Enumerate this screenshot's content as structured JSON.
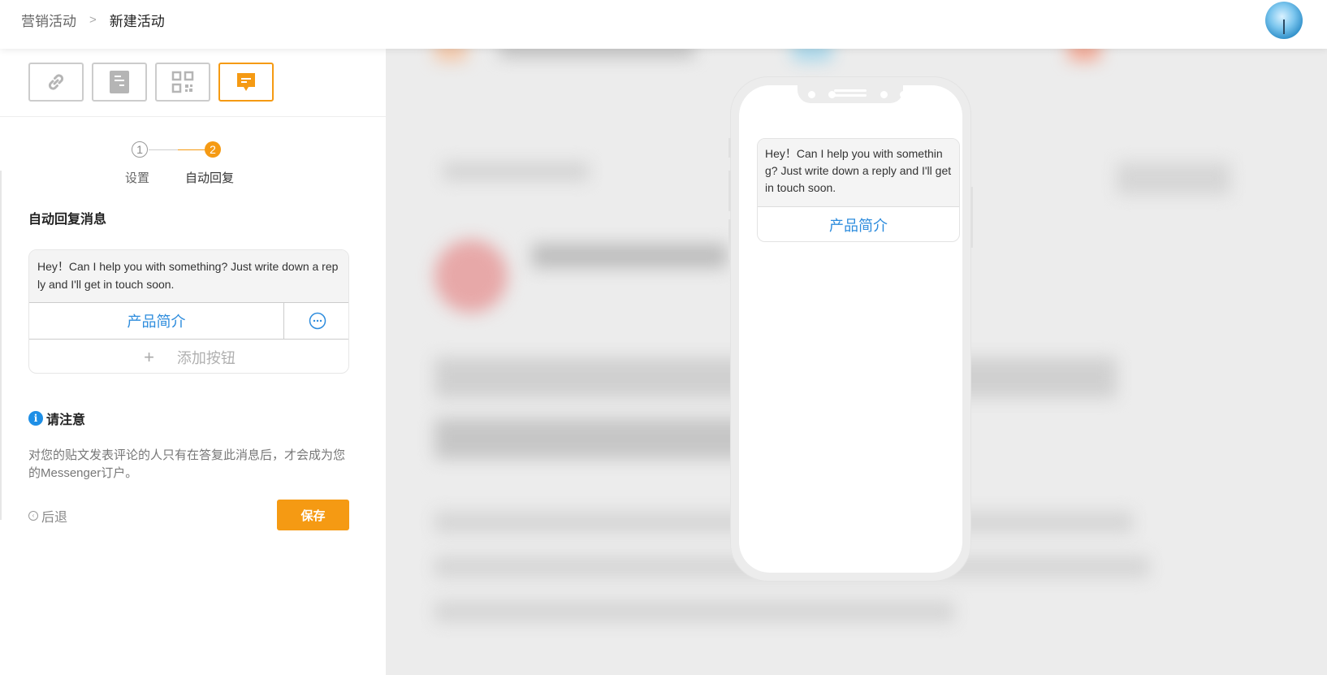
{
  "breadcrumb": {
    "parent": "营销活动",
    "separator": ">",
    "current": "新建活动"
  },
  "type_buttons": [
    {
      "icon": "link-icon",
      "active": false
    },
    {
      "icon": "document-icon",
      "active": false
    },
    {
      "icon": "qr-code-icon",
      "active": false
    },
    {
      "icon": "message-icon",
      "active": true
    }
  ],
  "steps": {
    "step1": {
      "number": "1",
      "label": "设置"
    },
    "step2": {
      "number": "2",
      "label": "自动回复"
    }
  },
  "auto_reply": {
    "section_title": "自动回复消息",
    "message_text": "Hey！Can I help you with something? Just write down a reply and I'll get in touch soon.",
    "button_label": "产品简介",
    "add_button_label": "添加按钮",
    "add_button_plus": "+"
  },
  "notice": {
    "icon_glyph": "i",
    "title": "请注意",
    "text": "对您的贴文发表评论的人只有在答复此消息后，才会成为您的Messenger订户。"
  },
  "footer": {
    "back_label": "后退",
    "save_label": "保存"
  },
  "preview": {
    "message_text": "Hey！Can I help you with something? Just write down a reply and I'll get in touch soon.",
    "button_label": "产品简介"
  },
  "colors": {
    "accent": "#f59a13",
    "link": "#2d8cdd",
    "info": "#1e8fe6"
  }
}
